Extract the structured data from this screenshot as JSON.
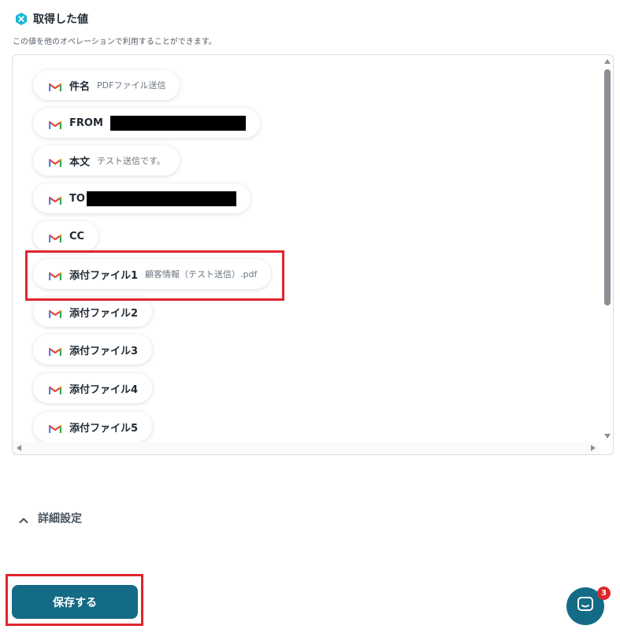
{
  "header": {
    "title": "取得した値",
    "description": "この値を他のオペレーションで利用することができます。"
  },
  "values": [
    {
      "label": "件名",
      "value": "PDFファイル送信"
    },
    {
      "label": "FROM",
      "value": ""
    },
    {
      "label": "本文",
      "value": "テスト送信です。"
    },
    {
      "label": "TO",
      "value": ""
    },
    {
      "label": "CC",
      "value": ""
    },
    {
      "label": "添付ファイル1",
      "value": "顧客情報（テスト送信）.pdf"
    },
    {
      "label": "添付ファイル2",
      "value": ""
    },
    {
      "label": "添付ファイル3",
      "value": ""
    },
    {
      "label": "添付ファイル4",
      "value": ""
    },
    {
      "label": "添付ファイル5",
      "value": ""
    }
  ],
  "advanced": {
    "label": "詳細設定"
  },
  "save_button": {
    "label": "保存する"
  },
  "chat": {
    "badge_count": "3"
  },
  "colors": {
    "accent": "#146b85",
    "highlight": "#e0262b",
    "gmail_red": "#ea4335"
  },
  "icons": {
    "header": "yoom-logo-icon",
    "chip": "gmail-icon",
    "advanced": "chevron-up-icon",
    "chat": "chat-icon"
  }
}
